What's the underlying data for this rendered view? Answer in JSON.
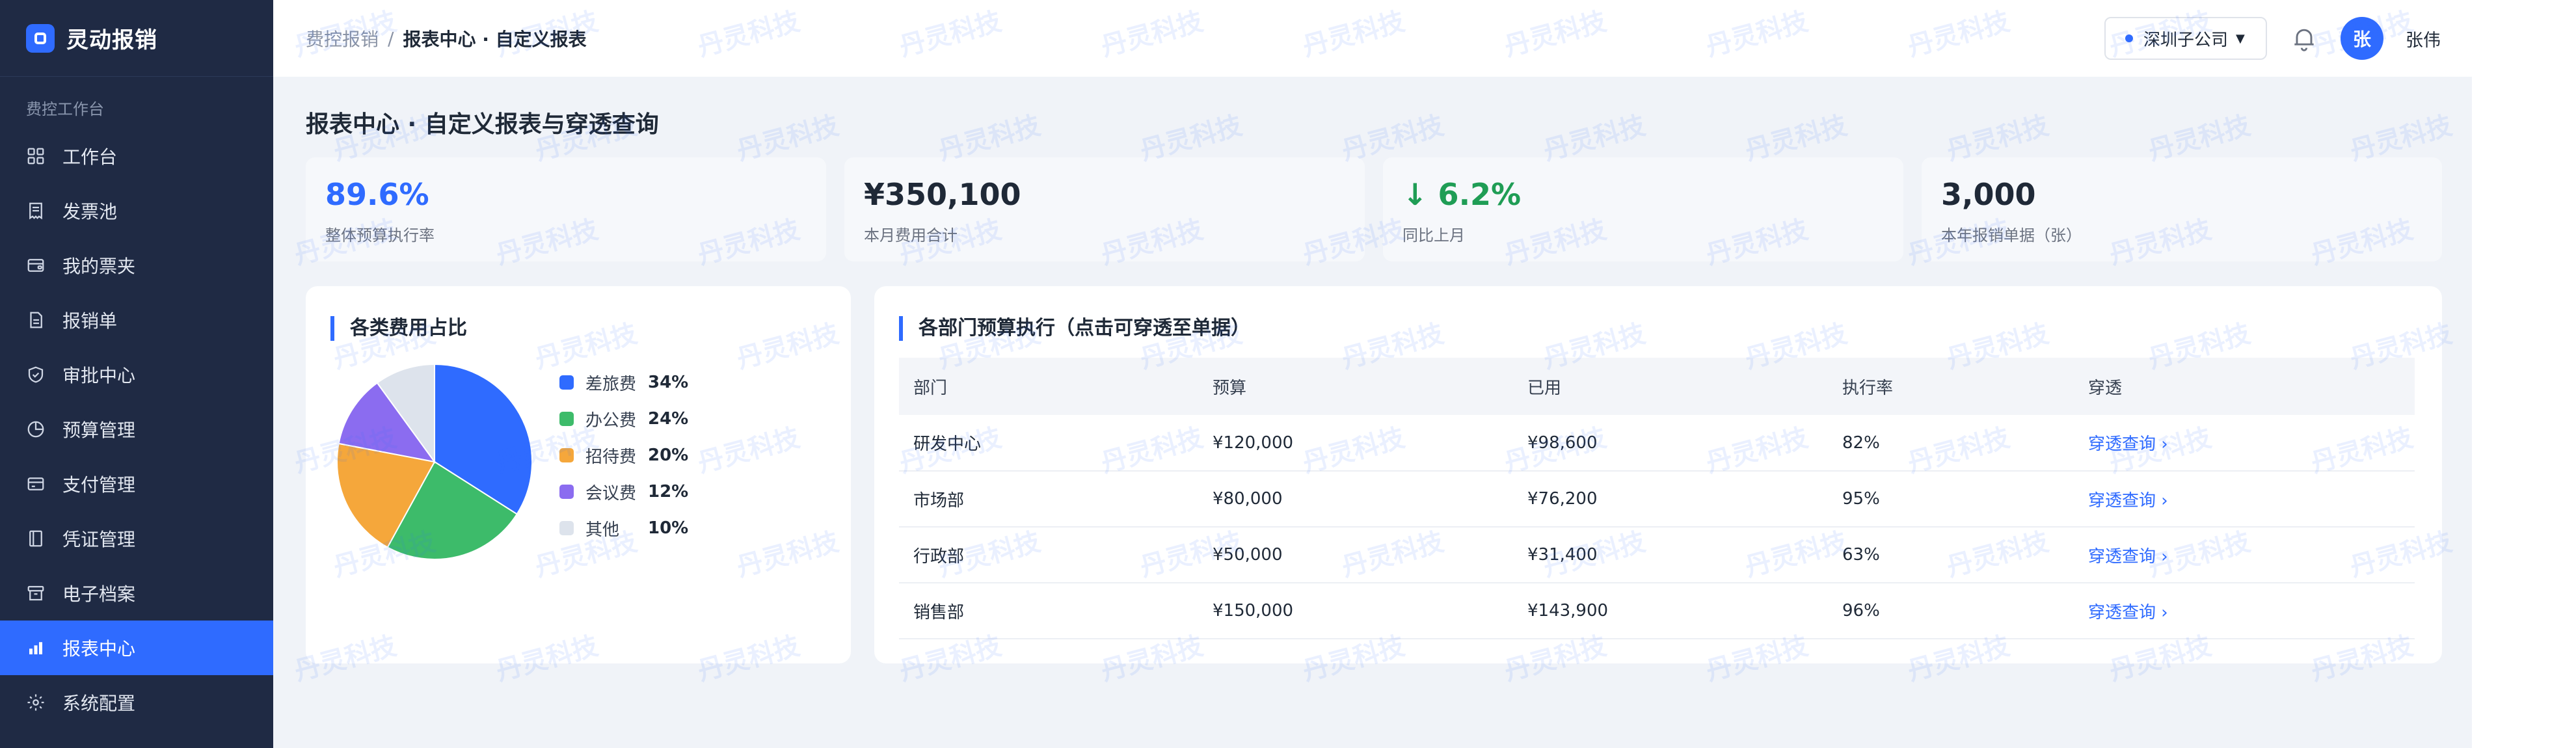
{
  "brand": {
    "name": "灵动报销"
  },
  "sidebar": {
    "section": "费控工作台",
    "items": [
      {
        "label": "工作台",
        "icon": "grid-icon"
      },
      {
        "label": "发票池",
        "icon": "receipt-icon"
      },
      {
        "label": "我的票夹",
        "icon": "wallet-icon"
      },
      {
        "label": "报销单",
        "icon": "document-icon"
      },
      {
        "label": "审批中心",
        "icon": "shield-check-icon"
      },
      {
        "label": "预算管理",
        "icon": "pie-icon"
      },
      {
        "label": "支付管理",
        "icon": "card-icon"
      },
      {
        "label": "凭证管理",
        "icon": "voucher-icon"
      },
      {
        "label": "电子档案",
        "icon": "archive-icon"
      },
      {
        "label": "报表中心",
        "icon": "bar-chart-icon",
        "active": true
      },
      {
        "label": "系统配置",
        "icon": "gear-icon"
      }
    ]
  },
  "header": {
    "breadcrumb": {
      "parent": "费控报销",
      "separator": "/",
      "current": "报表中心 · 自定义报表"
    },
    "company": "深圳子公司",
    "avatar_initial": "张",
    "user_name": "张伟"
  },
  "main": {
    "title": "报表中心 · 自定义报表与穿透查询",
    "kpis": [
      {
        "value": "89.6%",
        "label": "整体预算执行率"
      },
      {
        "value": "¥350,100",
        "label": "本月费用合计"
      },
      {
        "value": "↓ 6.2%",
        "label": "同比上月"
      },
      {
        "value": "3,000",
        "label": "本年报销单据（张）"
      }
    ],
    "pie_card": {
      "title": "各类费用占比"
    },
    "table_card": {
      "title": "各部门预算执行（点击可穿透至单据）",
      "columns": [
        "部门",
        "预算",
        "已用",
        "执行率",
        "穿透"
      ],
      "rows": [
        {
          "dept": "研发中心",
          "budget": "¥120,000",
          "used": "¥98,600",
          "rate": "82%",
          "link": "穿透查询 ›"
        },
        {
          "dept": "市场部",
          "budget": "¥80,000",
          "used": "¥76,200",
          "rate": "95%",
          "link": "穿透查询 ›"
        },
        {
          "dept": "行政部",
          "budget": "¥50,000",
          "used": "¥31,400",
          "rate": "63%",
          "link": "穿透查询 ›"
        },
        {
          "dept": "销售部",
          "budget": "¥150,000",
          "used": "¥143,900",
          "rate": "96%",
          "link": "穿透查询 ›"
        }
      ]
    }
  },
  "watermark": "丹灵科技",
  "colors": {
    "accent": "#2f6bff",
    "sidebar": "#1f2a44",
    "positive": "#1f9d55"
  },
  "chart_data": {
    "type": "pie",
    "title": "各类费用占比",
    "slices": [
      {
        "name": "差旅费",
        "value": 34,
        "label": "34%",
        "color": "#2f6bff"
      },
      {
        "name": "办公费",
        "value": 24,
        "label": "24%",
        "color": "#3dbb6a"
      },
      {
        "name": "招待费",
        "value": 20,
        "label": "20%",
        "color": "#f5a73b"
      },
      {
        "name": "会议费",
        "value": 12,
        "label": "12%",
        "color": "#8b6cf0"
      },
      {
        "name": "其他",
        "value": 10,
        "label": "10%",
        "color": "#dde3ec"
      }
    ],
    "legend": "right"
  }
}
